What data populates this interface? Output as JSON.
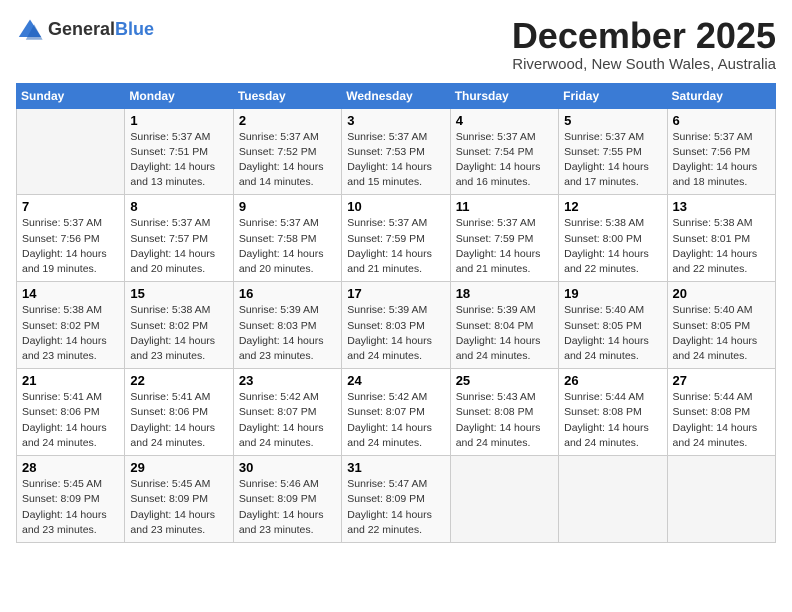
{
  "logo": {
    "text_general": "General",
    "text_blue": "Blue"
  },
  "header": {
    "month": "December 2025",
    "location": "Riverwood, New South Wales, Australia"
  },
  "weekdays": [
    "Sunday",
    "Monday",
    "Tuesday",
    "Wednesday",
    "Thursday",
    "Friday",
    "Saturday"
  ],
  "weeks": [
    [
      {
        "day": "",
        "info": ""
      },
      {
        "day": "1",
        "info": "Sunrise: 5:37 AM\nSunset: 7:51 PM\nDaylight: 14 hours\nand 13 minutes."
      },
      {
        "day": "2",
        "info": "Sunrise: 5:37 AM\nSunset: 7:52 PM\nDaylight: 14 hours\nand 14 minutes."
      },
      {
        "day": "3",
        "info": "Sunrise: 5:37 AM\nSunset: 7:53 PM\nDaylight: 14 hours\nand 15 minutes."
      },
      {
        "day": "4",
        "info": "Sunrise: 5:37 AM\nSunset: 7:54 PM\nDaylight: 14 hours\nand 16 minutes."
      },
      {
        "day": "5",
        "info": "Sunrise: 5:37 AM\nSunset: 7:55 PM\nDaylight: 14 hours\nand 17 minutes."
      },
      {
        "day": "6",
        "info": "Sunrise: 5:37 AM\nSunset: 7:56 PM\nDaylight: 14 hours\nand 18 minutes."
      }
    ],
    [
      {
        "day": "7",
        "info": "Sunrise: 5:37 AM\nSunset: 7:56 PM\nDaylight: 14 hours\nand 19 minutes."
      },
      {
        "day": "8",
        "info": "Sunrise: 5:37 AM\nSunset: 7:57 PM\nDaylight: 14 hours\nand 20 minutes."
      },
      {
        "day": "9",
        "info": "Sunrise: 5:37 AM\nSunset: 7:58 PM\nDaylight: 14 hours\nand 20 minutes."
      },
      {
        "day": "10",
        "info": "Sunrise: 5:37 AM\nSunset: 7:59 PM\nDaylight: 14 hours\nand 21 minutes."
      },
      {
        "day": "11",
        "info": "Sunrise: 5:37 AM\nSunset: 7:59 PM\nDaylight: 14 hours\nand 21 minutes."
      },
      {
        "day": "12",
        "info": "Sunrise: 5:38 AM\nSunset: 8:00 PM\nDaylight: 14 hours\nand 22 minutes."
      },
      {
        "day": "13",
        "info": "Sunrise: 5:38 AM\nSunset: 8:01 PM\nDaylight: 14 hours\nand 22 minutes."
      }
    ],
    [
      {
        "day": "14",
        "info": "Sunrise: 5:38 AM\nSunset: 8:02 PM\nDaylight: 14 hours\nand 23 minutes."
      },
      {
        "day": "15",
        "info": "Sunrise: 5:38 AM\nSunset: 8:02 PM\nDaylight: 14 hours\nand 23 minutes."
      },
      {
        "day": "16",
        "info": "Sunrise: 5:39 AM\nSunset: 8:03 PM\nDaylight: 14 hours\nand 23 minutes."
      },
      {
        "day": "17",
        "info": "Sunrise: 5:39 AM\nSunset: 8:03 PM\nDaylight: 14 hours\nand 24 minutes."
      },
      {
        "day": "18",
        "info": "Sunrise: 5:39 AM\nSunset: 8:04 PM\nDaylight: 14 hours\nand 24 minutes."
      },
      {
        "day": "19",
        "info": "Sunrise: 5:40 AM\nSunset: 8:05 PM\nDaylight: 14 hours\nand 24 minutes."
      },
      {
        "day": "20",
        "info": "Sunrise: 5:40 AM\nSunset: 8:05 PM\nDaylight: 14 hours\nand 24 minutes."
      }
    ],
    [
      {
        "day": "21",
        "info": "Sunrise: 5:41 AM\nSunset: 8:06 PM\nDaylight: 14 hours\nand 24 minutes."
      },
      {
        "day": "22",
        "info": "Sunrise: 5:41 AM\nSunset: 8:06 PM\nDaylight: 14 hours\nand 24 minutes."
      },
      {
        "day": "23",
        "info": "Sunrise: 5:42 AM\nSunset: 8:07 PM\nDaylight: 14 hours\nand 24 minutes."
      },
      {
        "day": "24",
        "info": "Sunrise: 5:42 AM\nSunset: 8:07 PM\nDaylight: 14 hours\nand 24 minutes."
      },
      {
        "day": "25",
        "info": "Sunrise: 5:43 AM\nSunset: 8:08 PM\nDaylight: 14 hours\nand 24 minutes."
      },
      {
        "day": "26",
        "info": "Sunrise: 5:44 AM\nSunset: 8:08 PM\nDaylight: 14 hours\nand 24 minutes."
      },
      {
        "day": "27",
        "info": "Sunrise: 5:44 AM\nSunset: 8:08 PM\nDaylight: 14 hours\nand 24 minutes."
      }
    ],
    [
      {
        "day": "28",
        "info": "Sunrise: 5:45 AM\nSunset: 8:09 PM\nDaylight: 14 hours\nand 23 minutes."
      },
      {
        "day": "29",
        "info": "Sunrise: 5:45 AM\nSunset: 8:09 PM\nDaylight: 14 hours\nand 23 minutes."
      },
      {
        "day": "30",
        "info": "Sunrise: 5:46 AM\nSunset: 8:09 PM\nDaylight: 14 hours\nand 23 minutes."
      },
      {
        "day": "31",
        "info": "Sunrise: 5:47 AM\nSunset: 8:09 PM\nDaylight: 14 hours\nand 22 minutes."
      },
      {
        "day": "",
        "info": ""
      },
      {
        "day": "",
        "info": ""
      },
      {
        "day": "",
        "info": ""
      }
    ]
  ]
}
